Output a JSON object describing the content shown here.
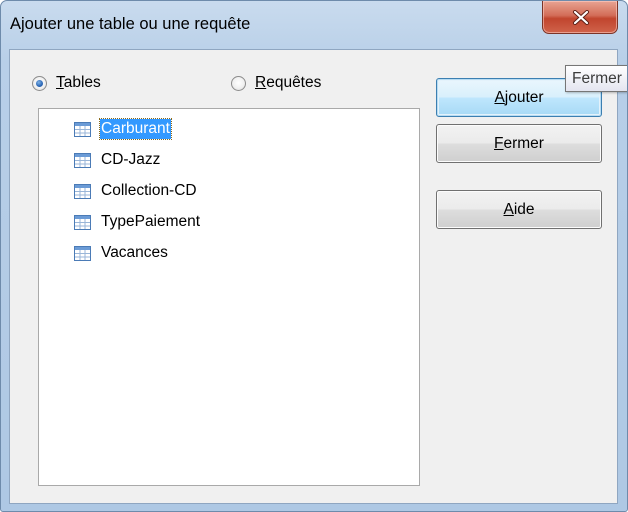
{
  "window": {
    "title": "Ajouter une table ou une requête"
  },
  "radios": {
    "tables": {
      "label_mnemonic": "T",
      "label_rest": "ables",
      "checked": true
    },
    "requetes": {
      "label_mnemonic": "R",
      "label_rest": "equêtes",
      "checked": false
    }
  },
  "list": {
    "items": [
      {
        "label": "Carburant",
        "selected": true,
        "icon": "table-icon"
      },
      {
        "label": "CD-Jazz",
        "selected": false,
        "icon": "table-icon"
      },
      {
        "label": "Collection-CD",
        "selected": false,
        "icon": "table-icon"
      },
      {
        "label": "TypePaiement",
        "selected": false,
        "icon": "table-icon"
      },
      {
        "label": "Vacances",
        "selected": false,
        "icon": "table-icon"
      }
    ]
  },
  "buttons": {
    "ajouter": {
      "mnemonic": "A",
      "rest": "jouter"
    },
    "fermer": {
      "mnemonic": "F",
      "rest": "ermer"
    },
    "aide": {
      "mnemonic": "A",
      "rest": "ide"
    }
  },
  "tooltip": {
    "text": "Fermer"
  },
  "colors": {
    "frame": "#b8cfe8",
    "client": "#f0f0f0",
    "selection": "#3399ff",
    "close_button": "#c1452e"
  }
}
